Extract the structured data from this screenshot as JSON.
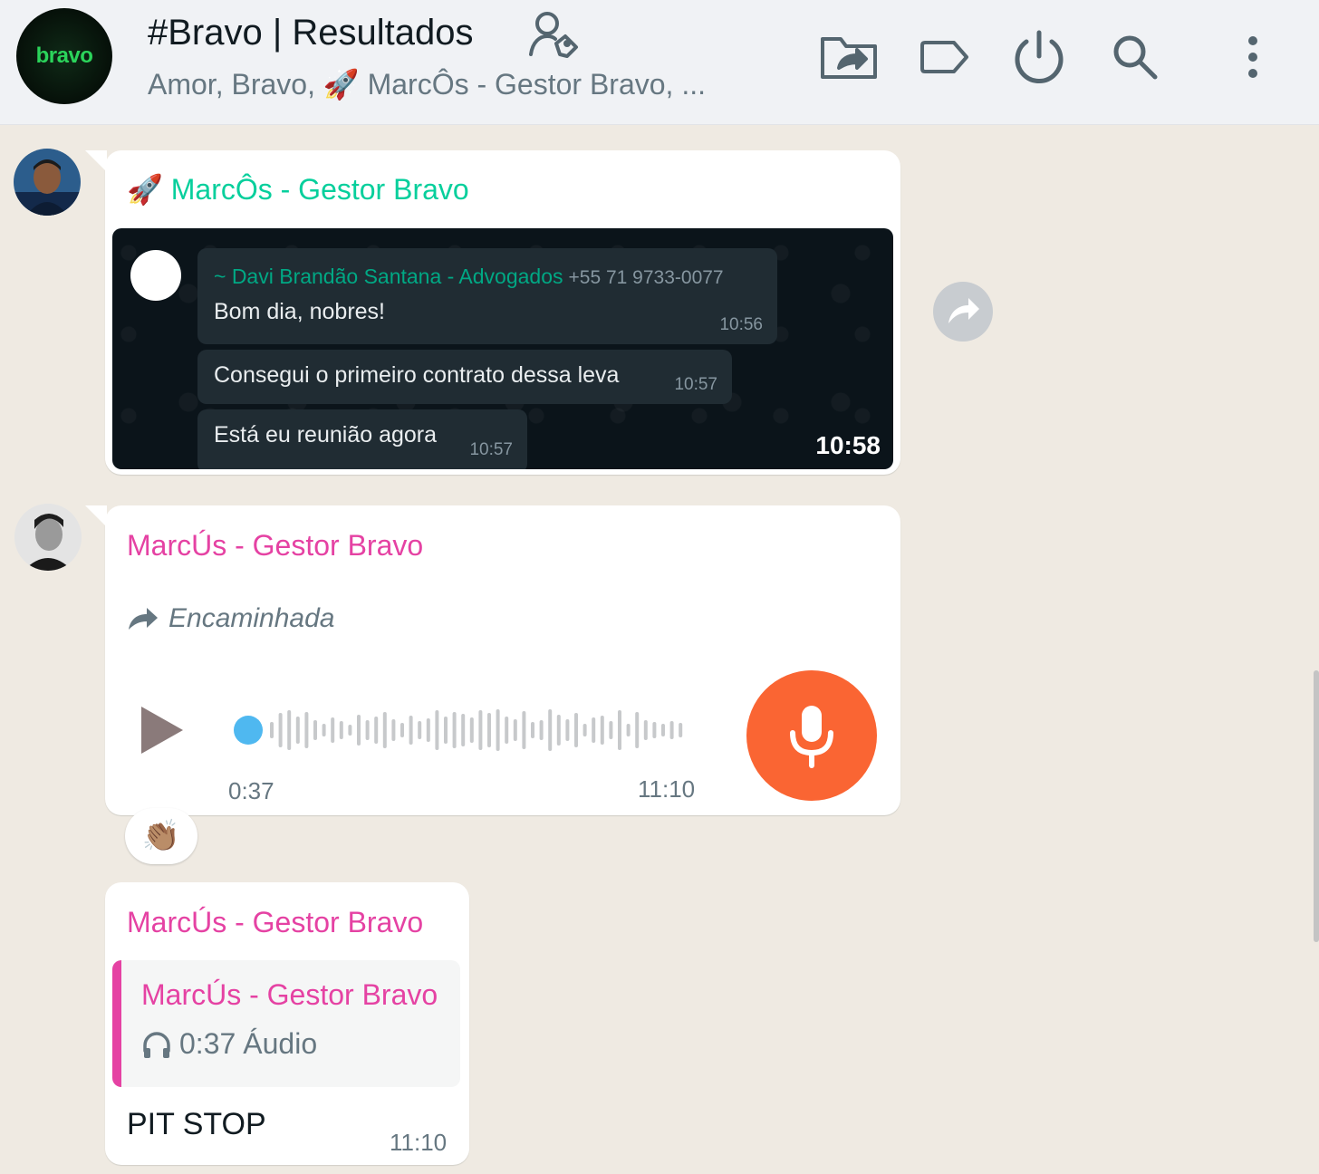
{
  "header": {
    "avatar_text": "bravo",
    "title": "#Bravo | Resultados",
    "subtitle_prefix": "Amor, Bravo,",
    "subtitle_emoji": "🚀",
    "subtitle_suffix": "MarcÔs - Gestor Bravo, ..."
  },
  "messages": {
    "m1": {
      "sender_emoji": "🚀",
      "sender": "MarcÔs - Gestor Bravo",
      "image": {
        "author": "~ Davi Brandão Santana - Advogados",
        "phone": "+55 71 9733-0077",
        "lines": [
          {
            "text": "Bom dia, nobres!",
            "time": "10:56"
          },
          {
            "text": "Consegui o primeiro contrato dessa leva",
            "time": "10:57"
          },
          {
            "text": "Está eu reunião agora",
            "time": "10:57"
          }
        ],
        "time": "10:58"
      }
    },
    "m2": {
      "sender": "MarcÚs - Gestor Bravo",
      "forwarded_label": "Encaminhada",
      "duration": "0:37",
      "time": "11:10",
      "reaction": "👏🏽"
    },
    "m3": {
      "sender": "MarcÚs - Gestor Bravo",
      "quote_sender": "MarcÚs - Gestor Bravo",
      "quote_duration": "0:37",
      "quote_type": "Áudio",
      "text": "PIT STOP",
      "time": "11:10"
    }
  },
  "colors": {
    "accent_green": "#06cf9c",
    "sender_pink": "#e542a3",
    "mic_orange": "#fa6533",
    "chat_bg": "#efeae2",
    "header_bg": "#f0f2f5"
  },
  "icons": [
    "community-admin-icon",
    "forward-icon",
    "label-icon",
    "power-icon",
    "search-icon",
    "menu-icon",
    "play-icon",
    "microphone-icon",
    "headphones-icon"
  ]
}
